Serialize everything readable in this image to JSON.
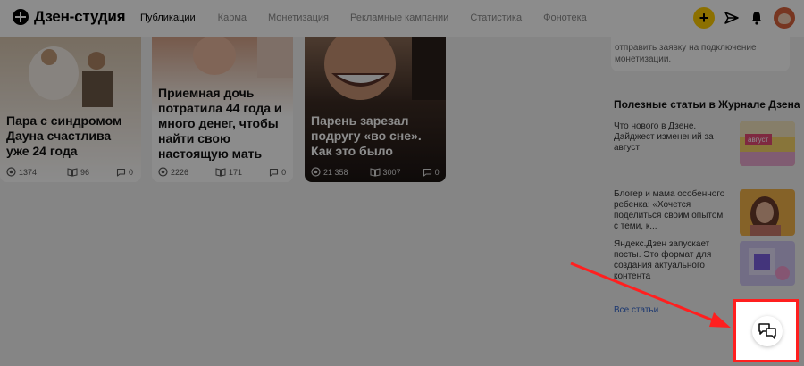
{
  "header": {
    "logo_text": "Дзен-студия",
    "nav": [
      {
        "label": "Публикации",
        "active": true
      },
      {
        "label": "Карма",
        "active": false
      },
      {
        "label": "Монетизация",
        "active": false
      },
      {
        "label": "Рекламные кампании",
        "active": false
      },
      {
        "label": "Статистика",
        "active": false
      },
      {
        "label": "Фонотека",
        "active": false
      }
    ],
    "plus_label": "+",
    "icons": [
      "plus-icon",
      "send-icon",
      "bell-icon",
      "avatar"
    ]
  },
  "cards": [
    {
      "title": "Пара с синдромом Дауна счастлива уже 24 года",
      "views": "1374",
      "reads": "96",
      "comments": "0"
    },
    {
      "title": "Приемная дочь потратила 44 года и много денег, чтобы найти свою настоящую мать",
      "views": "2226",
      "reads": "171",
      "comments": "0"
    },
    {
      "title": "Парень зарезал подругу «во сне». Как это было",
      "views": "21 358",
      "reads": "3007",
      "comments": "0"
    }
  ],
  "sidebar": {
    "promo_text": "отправить заявку на подключение монетизации.",
    "section_title": "Полезные статьи в Журнале Дзена",
    "articles": [
      {
        "text": "Что нового в Дзене. Дайджест изменений за август",
        "thumb_word": "август"
      },
      {
        "text": "Блогер и мама особенного ребенка: «Хочется поделиться своим опытом с теми, к...",
        "thumb_word": ""
      },
      {
        "text": "Яндекс.Дзен запускает посты. Это формат для создания актуального контента",
        "thumb_word": ""
      }
    ],
    "all_link": "Все статьи"
  },
  "colors": {
    "accent": "#ffcc00",
    "highlight": "#ff1f1f",
    "link": "#3366cc"
  },
  "chat_button": {
    "icon": "chat-icon"
  }
}
